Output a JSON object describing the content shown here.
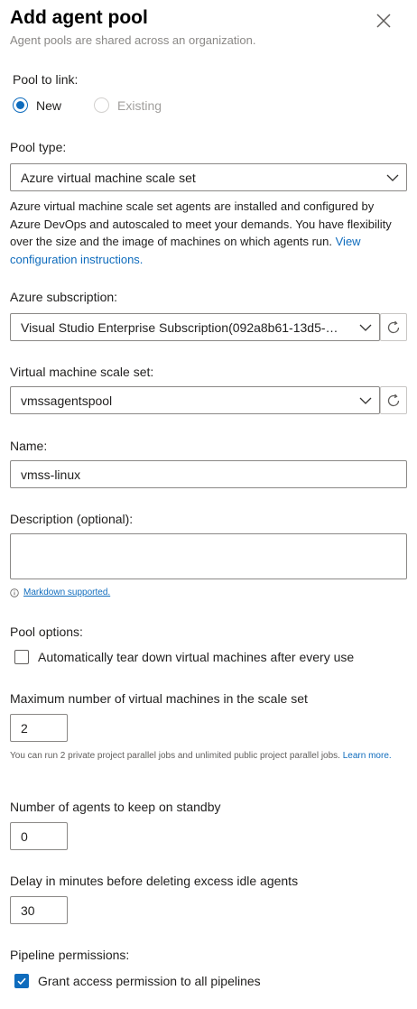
{
  "header": {
    "title": "Add agent pool",
    "subtitle": "Agent pools are shared across an organization."
  },
  "pool_to_link": {
    "label": "Pool to link:",
    "options": [
      {
        "label": "New",
        "selected": true,
        "enabled": true
      },
      {
        "label": "Existing",
        "selected": false,
        "enabled": false
      }
    ]
  },
  "pool_type": {
    "label": "Pool type:",
    "value": "Azure virtual machine scale set",
    "description": "Azure virtual machine scale set agents are installed and configured by Azure DevOps and autoscaled to meet your demands. You have flexibility over the size and the image of machines on which agents run.",
    "link_text": "View configuration instructions."
  },
  "subscription": {
    "label": "Azure subscription:",
    "value": "Visual Studio Enterprise Subscription(092a8b61-13d5-4e…"
  },
  "scale_set": {
    "label": "Virtual machine scale set:",
    "value": "vmssagentspool"
  },
  "name": {
    "label": "Name:",
    "value": "vmss-linux"
  },
  "description_field": {
    "label": "Description (optional):",
    "value": "",
    "hint_link": "Markdown supported."
  },
  "pool_options": {
    "label": "Pool options:",
    "teardown_label": "Automatically tear down virtual machines after every use",
    "teardown_checked": false
  },
  "max_vms": {
    "label": "Maximum number of virtual machines in the scale set",
    "value": "2",
    "note": "You can run 2 private project parallel jobs and unlimited public project parallel jobs.",
    "note_link": "Learn more."
  },
  "standby": {
    "label": "Number of agents to keep on standby",
    "value": "0"
  },
  "delay": {
    "label": "Delay in minutes before deleting excess idle agents",
    "value": "30"
  },
  "pipeline_permissions": {
    "label": "Pipeline permissions:",
    "grant_label": "Grant access permission to all pipelines",
    "grant_checked": true
  },
  "colors": {
    "accent": "#0f6cbd",
    "border": "#8a8886",
    "muted_text": "#8a8886"
  },
  "icons": [
    "close-icon",
    "chevron-down-icon",
    "refresh-icon",
    "info-icon",
    "checkmark-icon"
  ]
}
